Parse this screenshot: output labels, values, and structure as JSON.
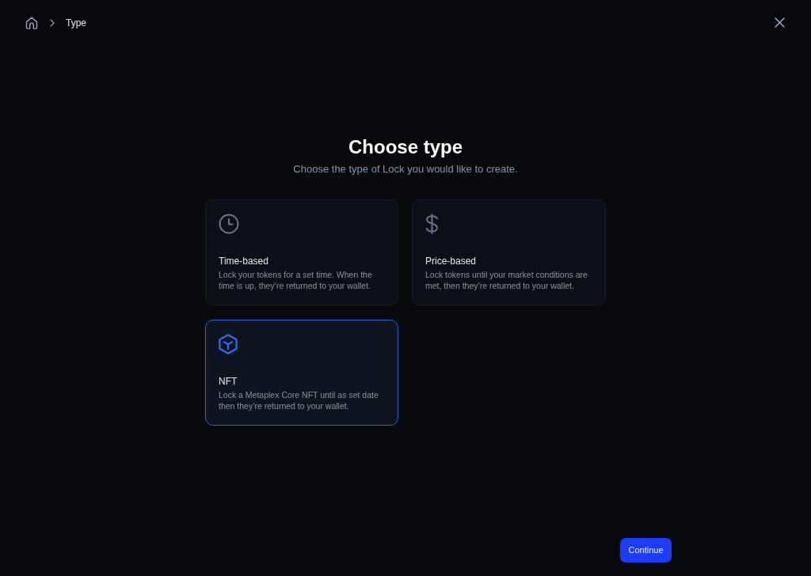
{
  "breadcrumb": {
    "current": "Type"
  },
  "heading": {
    "title": "Choose type",
    "subtitle": "Choose the type of Lock you would like to create."
  },
  "options": [
    {
      "kind": "time",
      "title": "Time-based",
      "description": "Lock your tokens for a set time. When the time is up, they’re returned to your wallet.",
      "selected": false
    },
    {
      "kind": "price",
      "title": "Price-based",
      "description": "Lock tokens until your market conditions are met, then they’re returned to your wallet.",
      "selected": false
    },
    {
      "kind": "nft",
      "title": "NFT",
      "description": "Lock a Metaplex Core NFT until as set date then they’re returned to your wallet.",
      "selected": true
    }
  ],
  "continue_button": {
    "label": "Continue"
  }
}
